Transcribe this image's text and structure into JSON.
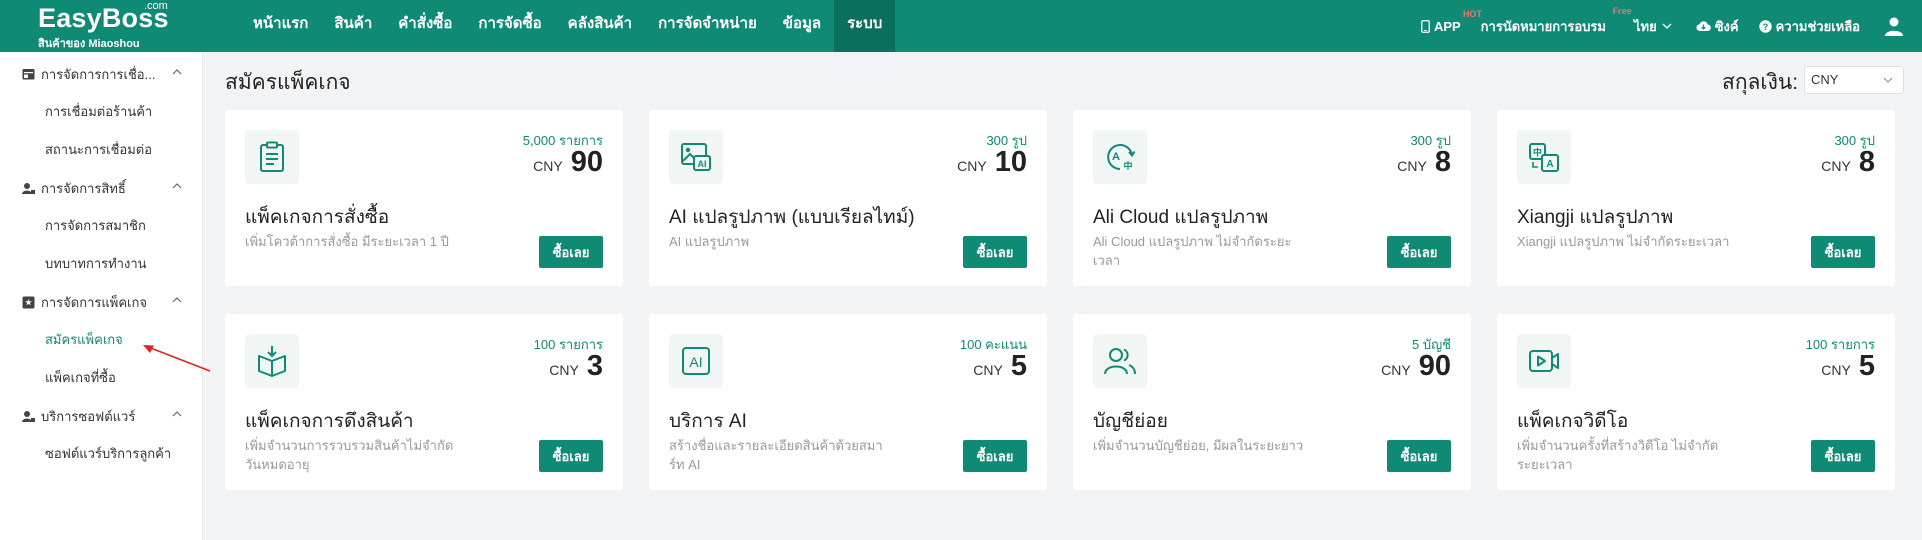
{
  "brand": {
    "name": "EasyBoss",
    "dotcom": ".com",
    "subtitle": "สินค้าของ Miaoshou"
  },
  "nav": [
    "หน้าแรก",
    "สินค้า",
    "คำสั่งซื้อ",
    "การจัดซื้อ",
    "คลังสินค้า",
    "การจัดจำหน่าย",
    "ข้อมูล",
    "ระบบ"
  ],
  "nav_active": "ระบบ",
  "top_right": {
    "app": "APP",
    "app_badge": "HOT",
    "training": "การนัดหมายการอบรม",
    "training_badge": "Free",
    "language": "ไทย",
    "sync": "ซิงค์",
    "help": "ความช่วยเหลือ"
  },
  "sidebar": {
    "groups": [
      {
        "label": "การจัดการการเชื่อ...",
        "icon": "store-icon",
        "items": [
          "การเชื่อมต่อร้านค้า",
          "สถานะการเชื่อมต่อ"
        ]
      },
      {
        "label": "การจัดการสิทธิ์",
        "icon": "user-key-icon",
        "items": [
          "การจัดการสมาชิก",
          "บทบาทการทำงาน"
        ]
      },
      {
        "label": "การจัดการแพ็คเกจ",
        "icon": "package-icon",
        "items": [
          "สมัครแพ็คเกจ",
          "แพ็คเกจที่ซื้อ"
        ]
      },
      {
        "label": "บริการซอฟต์แวร์",
        "icon": "user-key-icon",
        "items": [
          "ซอฟต์แวร์บริการลูกค้า"
        ]
      }
    ],
    "active_item": "สมัครแพ็คเกจ"
  },
  "page": {
    "title": "สมัครแพ็คเกจ",
    "currency_label": "สกุลเงิน:",
    "currency_value": "CNY"
  },
  "cards": [
    {
      "icon": "order-clipboard-icon",
      "qty": "5,000 รายการ",
      "currency": "CNY",
      "price": "90",
      "name": "แพ็คเกจการสั่งซื้อ",
      "desc": "เพิ่มโควต้าการสั่งซื้อ มีระยะเวลา 1 ปี",
      "button": "ซื้อเลย"
    },
    {
      "icon": "ai-image-icon",
      "qty": "300 รูป",
      "currency": "CNY",
      "price": "10",
      "name": "AI แปลรูปภาพ (แบบเรียลไทม์)",
      "desc": "AI แปลรูปภาพ",
      "button": "ซื้อเลย"
    },
    {
      "icon": "translate-cloud-icon",
      "qty": "300 รูป",
      "currency": "CNY",
      "price": "8",
      "name": "Ali Cloud แปลรูปภาพ",
      "desc": "Ali Cloud แปลรูปภาพ ไม่จำกัดระยะเวลา",
      "button": "ซื้อเลย"
    },
    {
      "icon": "translate-icon",
      "qty": "300 รูป",
      "currency": "CNY",
      "price": "8",
      "name": "Xiangji แปลรูปภาพ",
      "desc": "Xiangji แปลรูปภาพ ไม่จำกัดระยะเวลา",
      "button": "ซื้อเลย"
    },
    {
      "icon": "box-download-icon",
      "qty": "100 รายการ",
      "currency": "CNY",
      "price": "3",
      "name": "แพ็คเกจการดึงสินค้า",
      "desc": "เพิ่มจำนวนการรวบรวมสินค้าไม่จำกัดวันหมดอายุ",
      "button": "ซื้อเลย"
    },
    {
      "icon": "ai-icon",
      "qty": "100 คะแนน",
      "currency": "CNY",
      "price": "5",
      "name": "บริการ AI",
      "desc": "สร้างชื่อและรายละเอียดสินค้าด้วยสมาร์ท AI",
      "button": "ซื้อเลย"
    },
    {
      "icon": "users-icon",
      "qty": "5 บัญชี",
      "currency": "CNY",
      "price": "90",
      "name": "บัญชีย่อย",
      "desc": "เพิ่มจำนวนบัญชีย่อย, มีผลในระยะยาว",
      "button": "ซื้อเลย"
    },
    {
      "icon": "video-icon",
      "qty": "100 รายการ",
      "currency": "CNY",
      "price": "5",
      "name": "แพ็คเกจวิดีโอ",
      "desc": "เพิ่มจำนวนครั้งที่สร้างวิดีโอ ไม่จำกัดระยะเวลา",
      "button": "ซื้อเลย"
    }
  ],
  "colors": {
    "primary": "#0f8a75",
    "nav_active": "#0b6f5e",
    "arrow": "#e02424"
  }
}
